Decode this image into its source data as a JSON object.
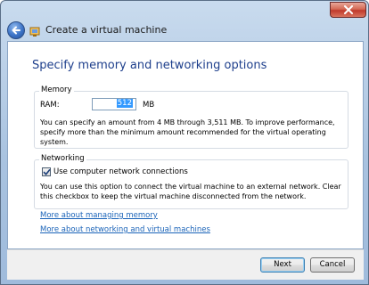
{
  "window": {
    "title": "Create a virtual machine"
  },
  "page": {
    "heading": "Specify memory and networking options"
  },
  "memory": {
    "legend": "Memory",
    "ram_label": "RAM:",
    "ram_value": "512",
    "ram_unit": "MB",
    "description": "You can specify an amount from 4 MB through 3,511 MB. To improve performance, specify more than the minimum amount recommended for the virtual operating system."
  },
  "networking": {
    "legend": "Networking",
    "checkbox_label": "Use computer network connections",
    "checkbox_checked": true,
    "description": "You can use this option to connect the virtual machine to an external network. Clear this checkbox to keep the virtual machine disconnected from the network."
  },
  "links": {
    "memory": "More about managing memory",
    "networking": "More about networking and virtual machines"
  },
  "buttons": {
    "next": "Next",
    "cancel": "Cancel"
  },
  "icons": {
    "back": "back-arrow-icon",
    "wizard": "virtual-machine-icon",
    "close": "close-icon",
    "check": "checkmark-icon"
  },
  "colors": {
    "heading": "#1e3f8c",
    "link": "#1a63b8",
    "close_button": "#c0392b"
  }
}
